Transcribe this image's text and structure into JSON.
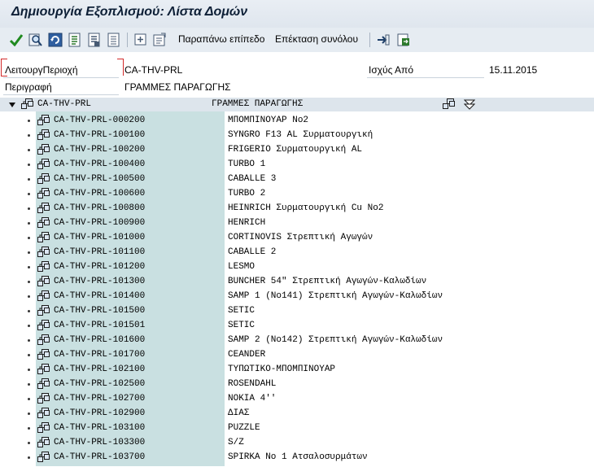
{
  "window": {
    "title": "Δημιουργία Εξοπλισμού: Λίστα Δομών"
  },
  "toolbar": {
    "icons": [
      "check-icon",
      "find-icon",
      "refresh-icon",
      "document-icon",
      "document2-icon",
      "list-icon",
      "add-icon",
      "notes-icon",
      "exit-icon",
      "export-icon"
    ],
    "level_up_label": "Παραπάνω επίπεδο",
    "expand_all_label": "Επέκταση συνόλου"
  },
  "header_fields": {
    "area_label": "ΛειτουργΠεριοχή",
    "area_value": "CA-THV-PRL",
    "valid_from_label": "Ισχύς Από",
    "valid_from_value": "15.11.2015",
    "description_label": "Περιγραφή",
    "description_value": "ΓΡΑΜΜΕΣ ΠΑΡΑΓΩΓΗΣ"
  },
  "tree": {
    "root": {
      "code": "CA-THV-PRL",
      "description": "ΓΡΑΜΜΕΣ ΠΑΡΑΓΩΓΗΣ"
    },
    "items": [
      {
        "code": "CA-THV-PRL-000200",
        "description": "ΜΠΟΜΠΙΝΟΥΑΡ No2"
      },
      {
        "code": "CA-THV-PRL-100100",
        "description": "SYNGRO F13 AL Συρματουργική"
      },
      {
        "code": "CA-THV-PRL-100200",
        "description": "FRIGERIO Συρματουργική AL"
      },
      {
        "code": "CA-THV-PRL-100400",
        "description": "TURBO 1"
      },
      {
        "code": "CA-THV-PRL-100500",
        "description": "CABALLE 3"
      },
      {
        "code": "CA-THV-PRL-100600",
        "description": "TURBO 2"
      },
      {
        "code": "CA-THV-PRL-100800",
        "description": "HEINRICH Συρματουργική Cu No2"
      },
      {
        "code": "CA-THV-PRL-100900",
        "description": "HENRICH"
      },
      {
        "code": "CA-THV-PRL-101000",
        "description": "CORTINOVIS Στρεπτική Αγωγών"
      },
      {
        "code": "CA-THV-PRL-101100",
        "description": "CABALLE 2"
      },
      {
        "code": "CA-THV-PRL-101200",
        "description": "LESMO"
      },
      {
        "code": "CA-THV-PRL-101300",
        "description": "BUNCHER 54\" Στρεπτική Αγωγών-Καλωδίων"
      },
      {
        "code": "CA-THV-PRL-101400",
        "description": "SAMP 1 (No141) Στρεπτική Αγωγών-Καλωδίων"
      },
      {
        "code": "CA-THV-PRL-101500",
        "description": "SETIC"
      },
      {
        "code": "CA-THV-PRL-101501",
        "description": "SETIC"
      },
      {
        "code": "CA-THV-PRL-101600",
        "description": "SAMP 2 (No142) Στρεπτική Αγωγών-Καλωδίων"
      },
      {
        "code": "CA-THV-PRL-101700",
        "description": "CEANDER"
      },
      {
        "code": "CA-THV-PRL-102100",
        "description": "ΤΥΠΩΤΙΚΟ-ΜΠΟΜΠΙΝΟΥΑΡ"
      },
      {
        "code": "CA-THV-PRL-102500",
        "description": "ROSENDAHL"
      },
      {
        "code": "CA-THV-PRL-102700",
        "description": "NOKIA 4''"
      },
      {
        "code": "CA-THV-PRL-102900",
        "description": "ΔΙΑΣ"
      },
      {
        "code": "CA-THV-PRL-103100",
        "description": "PUZZLE"
      },
      {
        "code": "CA-THV-PRL-103300",
        "description": "S/Z"
      },
      {
        "code": "CA-THV-PRL-103700",
        "description": "SPIRKA No 1 Ατσαλοσυρμάτων"
      }
    ]
  },
  "colors": {
    "tree_highlight": "#c9e0e1",
    "header_bg": "#dde5ec",
    "required_marker": "#d32a2a"
  }
}
